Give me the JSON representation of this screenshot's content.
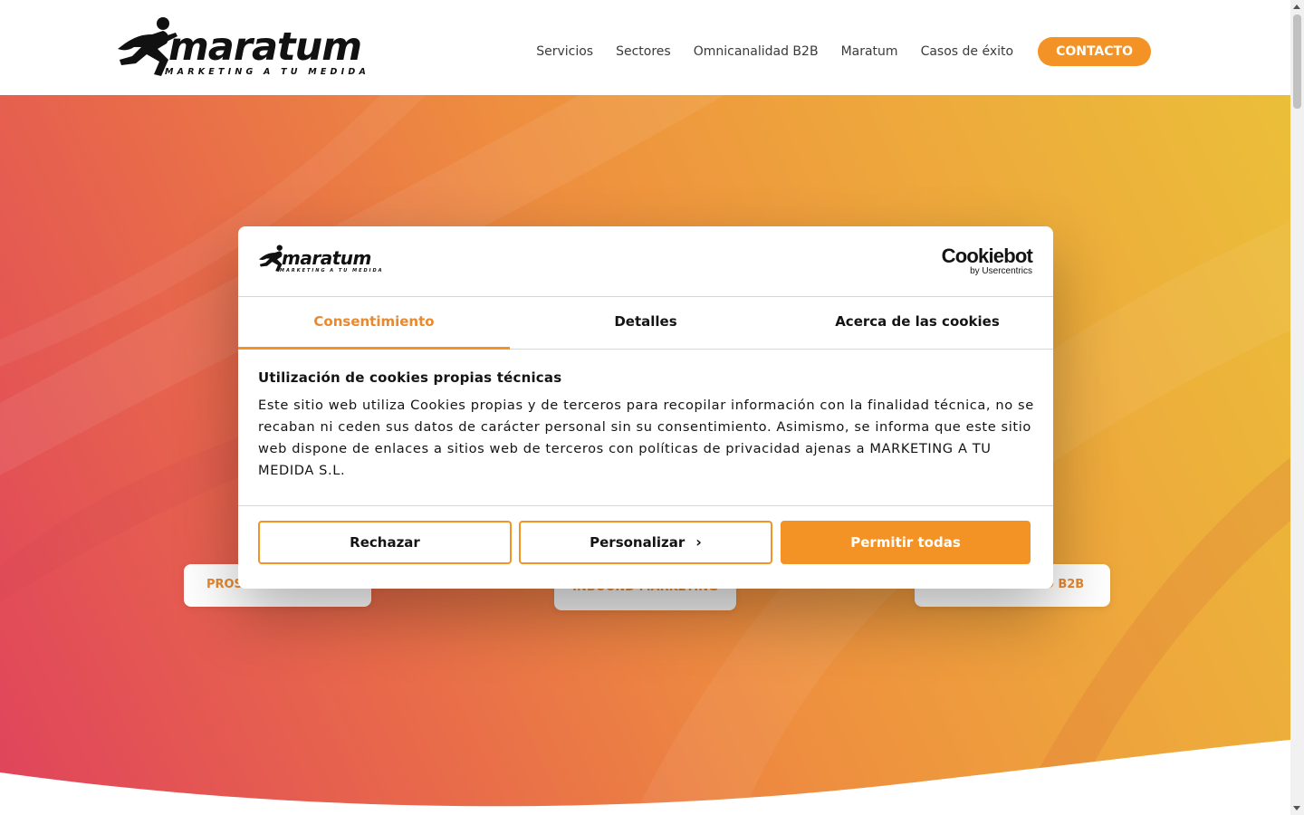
{
  "header": {
    "logo": {
      "name": "maratum",
      "tagline": "MARKETING A TU MEDIDA"
    },
    "nav": [
      {
        "label": "Servicios"
      },
      {
        "label": "Sectores"
      },
      {
        "label": "Omnicanalidad B2B"
      },
      {
        "label": "Maratum"
      },
      {
        "label": "Casos de éxito"
      }
    ],
    "cta_label": "CONTACTO"
  },
  "hero": {
    "pills": [
      {
        "label": "PROSPECCIÓN + ABM"
      },
      {
        "label": "INBOUND MARKETING"
      },
      {
        "label": "OMNICANALIDAD B2B"
      }
    ]
  },
  "cookie_modal": {
    "logo": {
      "name": "maratum",
      "tagline": "MARKETING A TU MEDIDA"
    },
    "provider": {
      "name": "Cookiebot",
      "by": "by Usercentrics"
    },
    "tabs": [
      {
        "label": "Consentimiento",
        "active": true
      },
      {
        "label": "Detalles",
        "active": false
      },
      {
        "label": "Acerca de las cookies",
        "active": false
      }
    ],
    "title": "Utilización de cookies propias técnicas",
    "text": "Este sitio web utiliza Cookies propias y de terceros para recopilar información con la finalidad técnica, no se recaban ni ceden sus datos de carácter personal sin su consentimiento. Asimismo, se informa que este sitio web dispone de enlaces a sitios web de terceros con políticas de privacidad ajenas a MARKETING A TU MEDIDA S.L.",
    "buttons": {
      "reject": "Rechazar",
      "customize": "Personalizar",
      "allow_all": "Permitir todas"
    }
  },
  "colors": {
    "accent": "#f39325",
    "accent_text": "#e8892f",
    "text": "#141414"
  },
  "icons": [
    "runner-logo-icon",
    "chevron-right-icon",
    "scroll-up-arrow-icon",
    "scroll-down-arrow-icon"
  ]
}
